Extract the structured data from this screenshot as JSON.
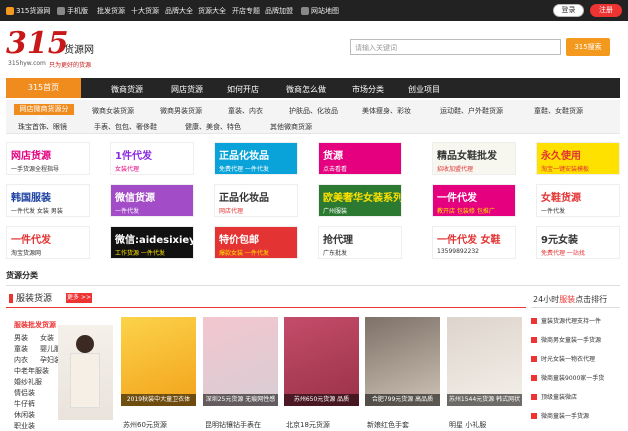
{
  "topbar": {
    "items": [
      "315货源网",
      "手机版",
      "批发货源",
      "十大货源",
      "品牌大全",
      "货源大全",
      "开店专题",
      "品牌加盟",
      "网站地图"
    ],
    "login": "登录",
    "register": "注册"
  },
  "header": {
    "logo_num": "315",
    "logo_name": "货源网",
    "logo_url": "315hyw.com",
    "logo_slogan": "只为更好的货源",
    "search_placeholder": "请输入关键词",
    "search_button": "315搜索"
  },
  "nav": {
    "home": "315首页",
    "items": [
      "微商货源",
      "网店货源",
      "如何开店",
      "微商怎么做",
      "市场分类",
      "创业项目"
    ]
  },
  "subnav": {
    "category": "网店微商货源分类»",
    "row1": [
      "微商女装货源",
      "微商男装货源",
      "童装、内衣",
      "护肤品、化妆品",
      "美体瘦身、彩妆",
      "运动鞋、户外鞋货源",
      "童鞋、女鞋货源"
    ],
    "row2": [
      "珠宝首饰、眼镜",
      "手表、包包、奢侈鞋",
      "健康、美食、特色",
      "其他微商货源"
    ]
  },
  "ads": [
    {
      "t1": "网店货源",
      "t2": "一手货源全程指导",
      "bg": "#ffffff",
      "c1": "#e4007f",
      "c2": "#333333"
    },
    {
      "t1": "1件代发",
      "t2": "女装代理",
      "bg": "#ffffff",
      "c1": "#8a2be2",
      "c2": "#e4007f"
    },
    {
      "t1": "正品化妆品",
      "t2": "免费代理 一件代发",
      "bg": "#0aa3d9",
      "c1": "#ffffff",
      "c2": "#ffffff"
    },
    {
      "t1": "货源",
      "t2": "点击看看",
      "bg": "#e4007f",
      "c1": "#ffffff",
      "c2": "#ffffff"
    },
    {
      "t1": "精品女鞋批发",
      "t2": "招收加盟代理",
      "bg": "#f7f7f0",
      "c1": "#333333",
      "c2": "#e33333"
    },
    {
      "t1": "永久使用",
      "t2": "淘宝一键安装模板",
      "bg": "#ffe100",
      "c1": "#e33333",
      "c2": "#e33333"
    },
    {
      "t1": "韩国服装",
      "t2": "一件代发 女装 男装",
      "bg": "#ffffff",
      "c1": "#1a3fa0",
      "c2": "#333333"
    },
    {
      "t1": "微信货源",
      "t2": "一件代发",
      "bg": "#a24cc8",
      "c1": "#ffffff",
      "c2": "#ffffff"
    },
    {
      "t1": "正品化妆品",
      "t2": "网店代理",
      "bg": "#ffffff",
      "c1": "#333333",
      "c2": "#e33333"
    },
    {
      "t1": "欧美奢华女装系列",
      "t2": "广州服装",
      "bg": "#2c7a32",
      "c1": "#ffe100",
      "c2": "#ffffff"
    },
    {
      "t1": "一件代发",
      "t2": "教开店 包装修 包推广",
      "bg": "#e4007f",
      "c1": "#ffffff",
      "c2": "#ffe100"
    },
    {
      "t1": "女鞋货源",
      "t2": "一件代发",
      "bg": "#ffffff",
      "c1": "#e33333",
      "c2": "#333333"
    },
    {
      "t1": "一件代发",
      "t2": "淘宝货源网",
      "bg": "#ffffff",
      "c1": "#e33333",
      "c2": "#333333"
    },
    {
      "t1": "微信:aidesixieye",
      "t2": "工作货源 一件代发",
      "bg": "#111111",
      "c1": "#ffffff",
      "c2": "#ffe100"
    },
    {
      "t1": "特价包邮",
      "t2": "爆款女装 一件代发",
      "bg": "#e33333",
      "c1": "#ffffff",
      "c2": "#ffe100"
    },
    {
      "t1": "抢代理",
      "t2": "广东批发",
      "bg": "#ffffff",
      "c1": "#333333",
      "c2": "#333333"
    },
    {
      "t1": "一件代发 女鞋",
      "t2": "13599892232",
      "bg": "#ffffff",
      "c1": "#e33333",
      "c2": "#333333"
    },
    {
      "t1": "9元女装",
      "t2": "免费代理 一站找",
      "bg": "#ffffff",
      "c1": "#333333",
      "c2": "#e33333"
    }
  ],
  "sections": {
    "source_category": "货源分类",
    "clothing": "服装货源",
    "more": "更多 >>",
    "cat_head": "服装批发货源",
    "cats": [
      [
        "男装",
        "女装"
      ],
      [
        "童装",
        "婴儿服装"
      ],
      [
        "内衣",
        "孕妇装"
      ],
      [
        "中老年服装"
      ],
      [
        "婚纱礼服"
      ],
      [
        "情侣装"
      ],
      [
        "牛仔裤"
      ],
      [
        "休闲装"
      ],
      [
        "职业装"
      ]
    ],
    "products": [
      {
        "cap": "2019秋装中大童卫衣体",
        "under": "苏州60元货源",
        "bg1": "#fbd34a",
        "bg2": "#f3a21b"
      },
      {
        "cap": "深圳25元货源 无痕网性感",
        "under": "昆明钻镶钻手表在",
        "bg1": "#f3c6cf",
        "bg2": "#d8cdd4"
      },
      {
        "cap": "苏州650元货源 品质",
        "under": "北京18元货源",
        "bg1": "#c44c6a",
        "bg2": "#9a3248"
      },
      {
        "cap": "合肥799元货源 高品质",
        "under": "新娘红色手套",
        "bg1": "#7d7168",
        "bg2": "#cfc3b6"
      },
      {
        "cap": "苏州1544元货源 韩式网状",
        "under": "明星 小礼服",
        "bg1": "#ddd4cc",
        "bg2": "#f4efe9"
      }
    ],
    "rank_prefix": "24小时",
    "rank_mid": "服装",
    "rank_suffix": "点击排行",
    "rank_items": [
      "童装货源代理支持一件",
      "微商男女童装一手货源",
      "时光女装一物衣代理",
      "微商童装9000家一手货",
      "顶级童装微店",
      "微商童装一手货源"
    ]
  },
  "colors": {
    "accent": "#f08c1e",
    "brand_red": "#e33333",
    "dark_bar": "#252525"
  }
}
